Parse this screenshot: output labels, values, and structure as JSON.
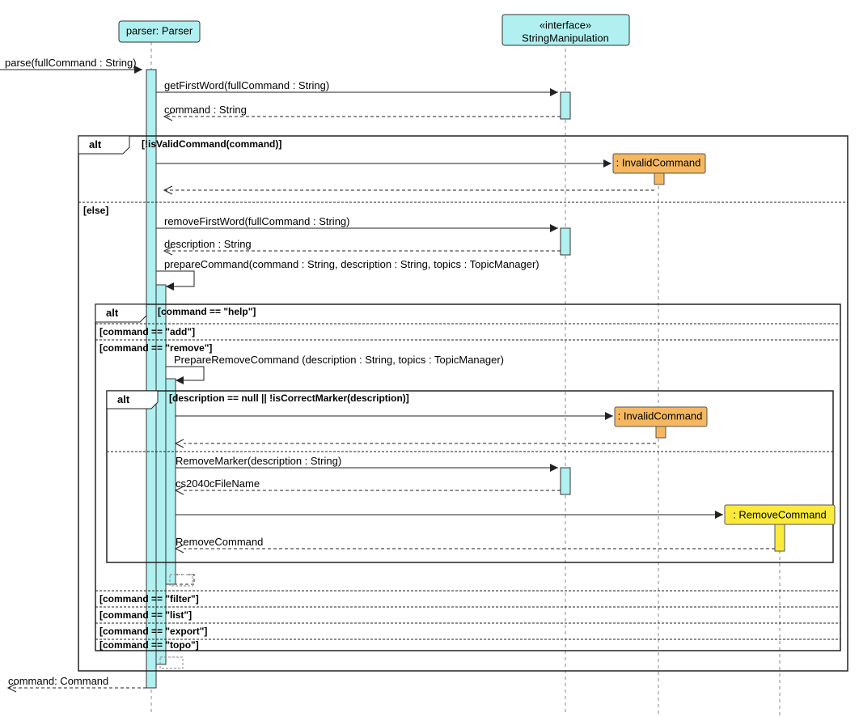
{
  "lifelines": {
    "parser": {
      "line1": "parser: Parser"
    },
    "string": {
      "line1": "«interface»",
      "line2": "StringManipulation"
    }
  },
  "entry": {
    "call": "parse(fullCommand : String)",
    "ret": "command: Command"
  },
  "m": {
    "getFirst": "getFirstWord(fullCommand : String)",
    "commandStr": "command : String",
    "removeFirst": "removeFirstWord(fullCommand : String)",
    "descStr": "description : String",
    "prepare": "prepareCommand(command : String, description : String, topics : TopicManager)",
    "prepRemove": "PrepareRemoveCommand (description : String, topics : TopicManager)",
    "removeMarker": "RemoveMarker(description : String)",
    "csfile": "cs2040cFileName",
    "removeCmdRet": "RemoveCommand"
  },
  "alt1": {
    "label": "alt",
    "g1": "[!isValidCommand(command)]",
    "g2": "[else]"
  },
  "alt2": {
    "label": "alt",
    "g1": "[command == \"help\"]",
    "g2": "[command == \"add\"]",
    "g3": "[command == \"remove\"]",
    "g4": "[command == \"filter\"]",
    "g5": "[command == \"list\"]",
    "g6": "[command == \"export\"]",
    "g7": "[command == \"topo\"]"
  },
  "alt3": {
    "label": "alt",
    "g1": "[description == null || !isCorrectMarker(description)]"
  },
  "objects": {
    "invalid": ": InvalidCommand",
    "remove": ": RemoveCommand"
  }
}
